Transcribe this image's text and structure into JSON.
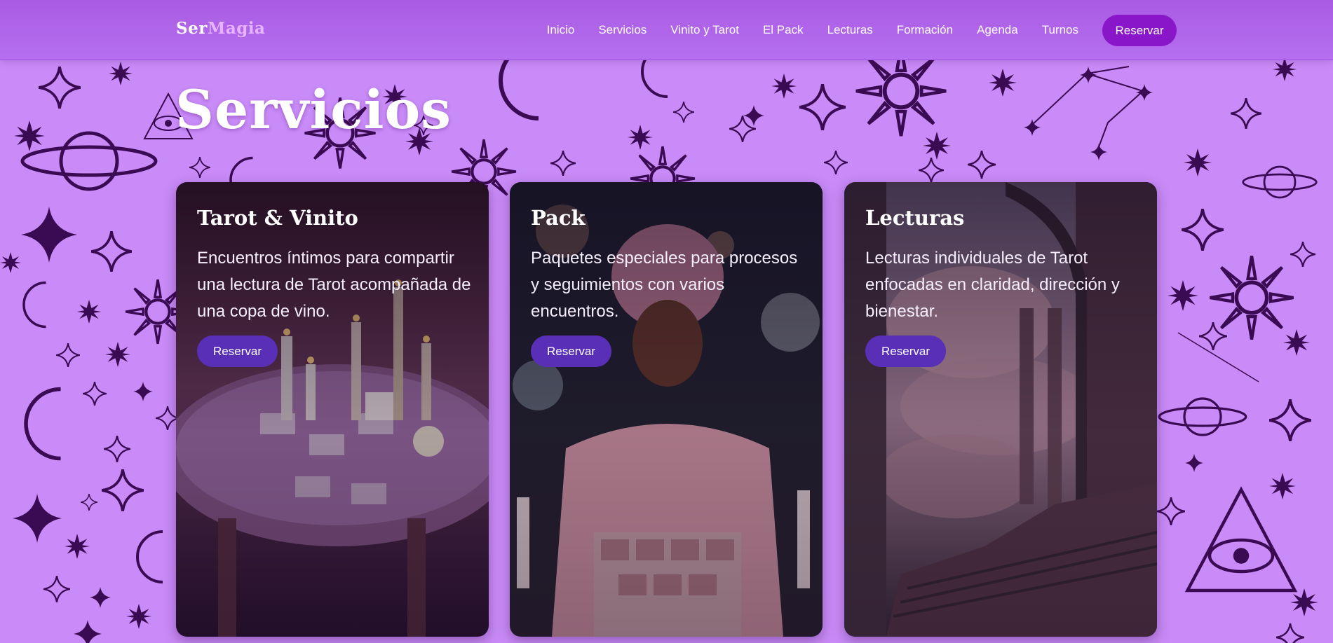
{
  "nav": {
    "logo_part1": "Ser",
    "logo_part2": "Magia",
    "links": [
      "Inicio",
      "Servicios",
      "Vinito y Tarot",
      "El Pack",
      "Lecturas",
      "Formación",
      "Agenda",
      "Turnos"
    ],
    "cta_label": "Reservar"
  },
  "section": {
    "title": "Servicios"
  },
  "cards": [
    {
      "title": "Tarot & Vinito",
      "description": "Encuentros íntimos para compartir una lectura de Tarot acompañada de una copa de vino.",
      "button_label": "Reservar"
    },
    {
      "title": "Pack",
      "description": "Paquetes especiales para procesos y seguimientos con varios encuentros.",
      "button_label": "Reservar"
    },
    {
      "title": "Lecturas",
      "description": "Lecturas individuales de Tarot enfocadas en claridad, dirección y bienestar.",
      "button_label": "Reservar"
    }
  ],
  "colors": {
    "page_background": "#c98bf7",
    "pattern_ink": "#3a0a52",
    "nav_cta": "#8a16c9",
    "card_button": "#5a2fb8"
  }
}
